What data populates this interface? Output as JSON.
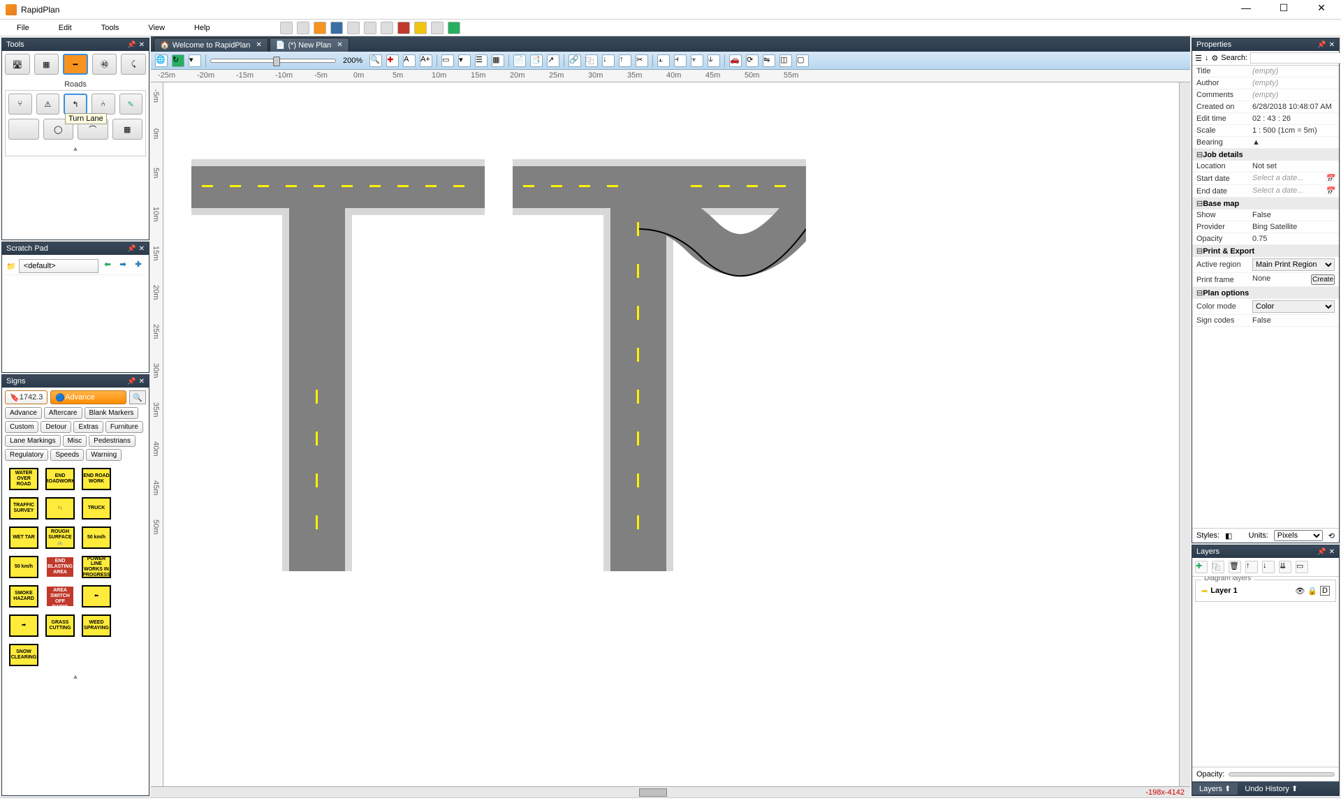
{
  "app": {
    "title": "RapidPlan"
  },
  "window_controls": {
    "min": "—",
    "max": "☐",
    "close": "✕"
  },
  "menu": [
    "File",
    "Edit",
    "Tools",
    "View",
    "Help"
  ],
  "toolbar_icons": [
    "new",
    "open",
    "save-all",
    "save",
    "print",
    "page-setup",
    "export",
    "delete",
    "undo",
    "wizard",
    "exit"
  ],
  "doc_tabs": [
    {
      "label": "Welcome to RapidPlan",
      "active": false
    },
    {
      "label": "(*) New Plan",
      "active": true
    }
  ],
  "canvas_toolbar": {
    "zoom_value": "200%",
    "buttons_left": [
      "globe",
      "refresh",
      "dropdown"
    ],
    "buttons_mid": [
      "zoom-in",
      "crosshair",
      "text",
      "text-plus"
    ],
    "buttons_grid": [
      "toggle-a",
      "toggle-b",
      "list",
      "grid"
    ],
    "buttons_page": [
      "page",
      "pages",
      "page-out"
    ],
    "buttons_ops": [
      "link",
      "group",
      "send-back",
      "bring-front",
      "cut"
    ],
    "buttons_align": [
      "align-l",
      "align-c",
      "align-r",
      "align-t"
    ],
    "buttons_extra": [
      "car",
      "rotate",
      "flip",
      "crop",
      "blank"
    ]
  },
  "ruler_h": [
    "-25m",
    "-20m",
    "-15m",
    "-10m",
    "-5m",
    "0m",
    "5m",
    "10m",
    "15m",
    "20m",
    "25m",
    "30m",
    "35m",
    "40m",
    "45m",
    "50m",
    "55m"
  ],
  "ruler_v": [
    "-5m",
    "0m",
    "5m",
    "10m",
    "15m",
    "20m",
    "25m",
    "30m",
    "35m",
    "40m",
    "45m",
    "50m"
  ],
  "coord_readout": "-198x-4142",
  "tools_panel": {
    "title": "Tools",
    "group_label": "Roads",
    "tooltip": "Turn Lane",
    "row1": [
      "road-curve",
      "road-roundabout",
      "road-straight",
      "road-speed",
      "road-arc"
    ],
    "row2": [
      "lane-split",
      "lane-warn",
      "turn-lane",
      "lane-merge",
      "pencil"
    ],
    "row3": [
      "blank",
      "roundabout",
      "curve-dark",
      "grid"
    ]
  },
  "scratchpad": {
    "title": "Scratch Pad",
    "default_item": "<default>",
    "nav": {
      "back": "⬅",
      "fwd": "➡",
      "add": "✚"
    }
  },
  "signs": {
    "title": "Signs",
    "version": "1742.3",
    "category_selected": "Advance",
    "categories": [
      "Advance",
      "Aftercare",
      "Blank Markers",
      "Custom",
      "Detour",
      "Extras",
      "Furniture",
      "Lane Markings",
      "Misc",
      "Pedestrians",
      "Regulatory",
      "Speeds",
      "Warning"
    ],
    "items": [
      "WATER OVER ROAD",
      "END ROADWORK",
      "END ROAD WORK",
      "TRAFFIC SURVEY",
      "↑↓",
      "TRUCK",
      "WET TAR",
      "ROUGH SURFACE 🚲",
      "50 km/h",
      "50 km/h",
      "END BLASTING AREA",
      "POWER LINE WORKS IN PROGRESS",
      "SMOKE HAZARD",
      "BLASTING AREA SWITCH OFF RADIO",
      "⬅",
      "➡",
      "GRASS CUTTING",
      "WEED SPRAYING",
      "SNOW CLEARING"
    ]
  },
  "properties": {
    "title": "Properties",
    "search_label": "Search:",
    "rows": [
      {
        "k": "Title",
        "v": "(empty)",
        "empty": true
      },
      {
        "k": "Author",
        "v": "(empty)",
        "empty": true
      },
      {
        "k": "Comments",
        "v": "(empty)",
        "empty": true
      },
      {
        "k": "Created on",
        "v": "6/28/2018 10:48:07 AM"
      },
      {
        "k": "Edit time",
        "v": "02 : 43 : 26"
      },
      {
        "k": "Scale",
        "v": "1 : 500   (1cm = 5m)"
      },
      {
        "k": "Bearing",
        "v": "▲"
      }
    ],
    "sections": {
      "job": {
        "label": "Job details",
        "rows": [
          {
            "k": "Location",
            "v": "Not set"
          },
          {
            "k": "Start date",
            "v": "Select a date...",
            "empty": true,
            "picker": true
          },
          {
            "k": "End date",
            "v": "Select a date...",
            "empty": true,
            "picker": true
          }
        ]
      },
      "basemap": {
        "label": "Base map",
        "rows": [
          {
            "k": "Show",
            "v": "False"
          },
          {
            "k": "Provider",
            "v": "Bing Satellite"
          },
          {
            "k": "Opacity",
            "v": "0.75"
          }
        ]
      },
      "print": {
        "label": "Print & Export",
        "rows": [
          {
            "k": "Active region",
            "v": "Main Print Region",
            "select": true
          },
          {
            "k": "Print frame",
            "v": "None",
            "button": "Create"
          }
        ]
      },
      "plan": {
        "label": "Plan options",
        "rows": [
          {
            "k": "Color mode",
            "v": "Color",
            "select": true
          },
          {
            "k": "Sign codes",
            "v": "False"
          }
        ]
      }
    },
    "styles_label": "Styles:",
    "units_label": "Units:",
    "units_value": "Pixels"
  },
  "layers": {
    "title": "Layers",
    "toolbar": [
      "add",
      "dup",
      "delete",
      "up",
      "down",
      "merge",
      "flatten"
    ],
    "section_label": "Diagram layers",
    "items": [
      {
        "name": "Layer 1",
        "visible": true
      }
    ],
    "opacity_label": "Opacity:",
    "bottom_tabs": [
      "Layers",
      "Undo History"
    ]
  }
}
